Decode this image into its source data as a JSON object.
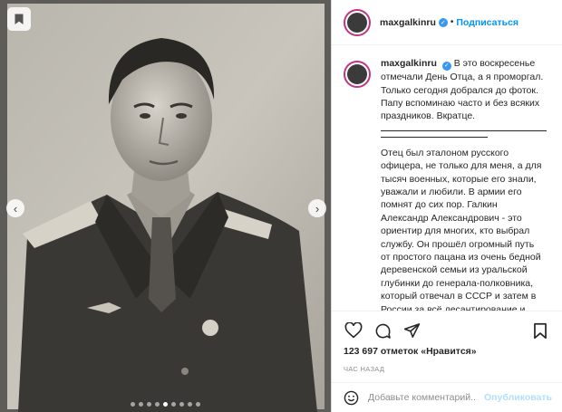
{
  "post": {
    "username": "maxgalkinru",
    "separator": "•",
    "follow_label": "Подписаться",
    "caption_lines": [
      "В это воскресенье",
      "отмечали День Отца, а я проморгал.",
      "Только сегодня добрался до фоток.",
      "Папу вспоминаю часто и без всяких",
      "праздников. Вкратце."
    ],
    "body_lines": [
      "Отец был эталоном русского",
      "офицера, не только для меня, а для",
      "тысяч военных, которые его знали,",
      "уважали и любили. В армии его",
      "помнят до сих пор. Галкин",
      "Александр Александрович - это",
      "ориентир для многих, кто выбрал",
      "службу. Он прошёл огромный путь",
      "от простого пацана из очень бедной",
      "деревенской семьи из уральской",
      "глубинки до генерала-полковника,",
      "который отвечал в СССР и затем в",
      "России за всё десантирование и"
    ],
    "likes_text": "123 697 отметок «Нравится»",
    "time_text": "ЧАС НАЗАД",
    "comment_placeholder": "Добавьте комментарий...",
    "publish_label": "Опубликовать"
  },
  "carousel": {
    "prev_glyph": "‹",
    "next_glyph": "›",
    "dot_count": 9,
    "active_dot": 4
  },
  "icons": {
    "photo_bookmark": "bookmark-filled-icon",
    "like": "heart-icon",
    "comment": "comment-icon",
    "share": "paper-plane-icon",
    "save": "bookmark-icon",
    "emoji": "emoji-icon",
    "verified": "verified-badge-icon"
  },
  "colors": {
    "link_blue": "#0095f6",
    "verified_blue": "#3897f0",
    "publish_disabled": "#b2dffc",
    "muted": "#8e8e8e",
    "story_ring": "#c13584"
  }
}
